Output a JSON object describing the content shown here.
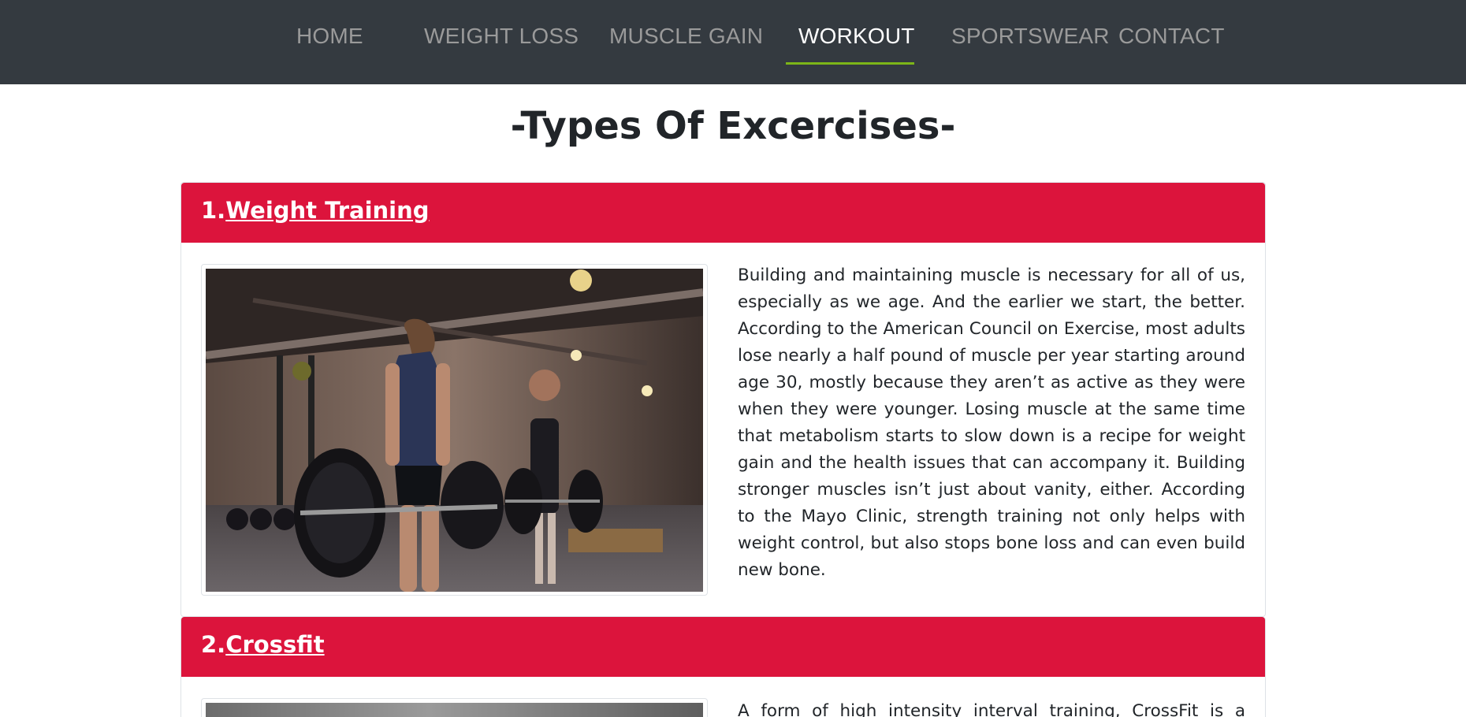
{
  "nav": {
    "items": [
      {
        "label": "HOME"
      },
      {
        "label": "WEIGHT LOSS"
      },
      {
        "label": "MUSCLE GAIN"
      },
      {
        "label": "WORKOUT"
      },
      {
        "label": "SPORTSWEAR"
      },
      {
        "label": "CONTACT"
      }
    ],
    "active": "WORKOUT",
    "accent_color": "#7cb518"
  },
  "page_title": "-Types Of Excercises-",
  "sections": [
    {
      "number": "1.",
      "title": "Weight Training",
      "text": "Building and maintaining muscle is necessary for all of us, especially as we age. And the earlier we start, the better. According to the American Council on Exercise, most adults lose nearly a half pound of muscle per year starting around age 30, mostly because they aren’t as active as they were when they were younger. Losing muscle at the same time that metabolism starts to slow down is a recipe for weight gain and the health issues that can accompany it. Building stronger muscles isn’t just about vanity, either. According to the Mayo Clinic, strength training not only helps with weight control, but also stops bone loss and can even build new bone."
    },
    {
      "number": "2.",
      "title": "Crossfit",
      "text": "A form of high intensity interval training, CrossFit is a strength"
    }
  ],
  "colors": {
    "nav_bg": "#343a40",
    "header_bg": "#dc143c"
  }
}
